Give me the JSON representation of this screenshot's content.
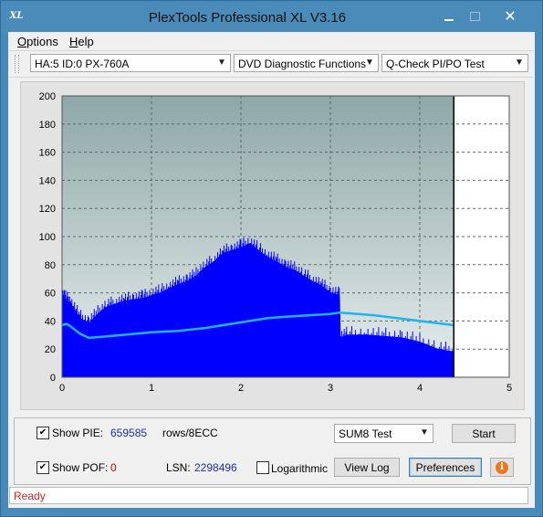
{
  "window": {
    "title": "PlexTools Professional XL V3.16",
    "app_icon": "XL"
  },
  "menu": {
    "options": "Options",
    "help": "Help"
  },
  "toolbar": {
    "drive": "HA:5 ID:0  PX-760A",
    "function": "DVD Diagnostic Functions",
    "test": "Q-Check PI/PO Test"
  },
  "chart_data": {
    "type": "area",
    "x_ticks": [
      "0",
      "1",
      "2",
      "3",
      "4",
      "5"
    ],
    "y_ticks": [
      "0",
      "20",
      "40",
      "60",
      "80",
      "100",
      "120",
      "140",
      "160",
      "180",
      "200"
    ],
    "xlim": [
      0,
      5
    ],
    "ylim": [
      0,
      200
    ],
    "grid": true,
    "end_marker_x": 4.38,
    "series": [
      {
        "color": "#0000ff",
        "x": [
          0,
          0.05,
          0.1,
          0.2,
          0.3,
          0.4,
          0.5,
          0.6,
          0.7,
          0.8,
          0.9,
          1.0,
          1.1,
          1.2,
          1.3,
          1.4,
          1.5,
          1.6,
          1.7,
          1.8,
          1.9,
          2.0,
          2.1,
          2.2,
          2.3,
          2.4,
          2.5,
          2.6,
          2.7,
          2.8,
          2.9,
          3.0,
          3.1,
          3.11,
          3.2,
          3.4,
          3.6,
          3.8,
          4.0,
          4.2,
          4.38
        ],
        "y": [
          58,
          55,
          52,
          42,
          38,
          45,
          50,
          52,
          54,
          55,
          56,
          58,
          60,
          63,
          66,
          68,
          72,
          78,
          82,
          88,
          90,
          92,
          95,
          90,
          85,
          82,
          78,
          76,
          72,
          68,
          65,
          60,
          58,
          28,
          30,
          30,
          29,
          28,
          25,
          20,
          18
        ]
      },
      {
        "color": "#1eb4ec",
        "x": [
          0,
          0.05,
          0.1,
          0.2,
          0.3,
          0.5,
          1.0,
          1.3,
          1.6,
          2.0,
          2.3,
          2.5,
          3.0,
          3.1,
          3.5,
          4.0,
          4.38
        ],
        "y": [
          37,
          38,
          36,
          31,
          28,
          29,
          32,
          33,
          35,
          39,
          42,
          43,
          45,
          46,
          44,
          40,
          37
        ]
      }
    ]
  },
  "stats": {
    "show_pie": "Show PIE:",
    "pie_value": "659585",
    "pie_unit": "rows/8ECC",
    "show_pof": "Show POF:",
    "pof_value": "0",
    "lsn_label": "LSN:",
    "lsn_value": "2298496",
    "logarithmic": "Logarithmic"
  },
  "controls": {
    "sum_test": "SUM8 Test",
    "start": "Start",
    "view_log": "View Log",
    "preferences": "Preferences",
    "info_icon": "info-icon"
  },
  "status": "Ready"
}
